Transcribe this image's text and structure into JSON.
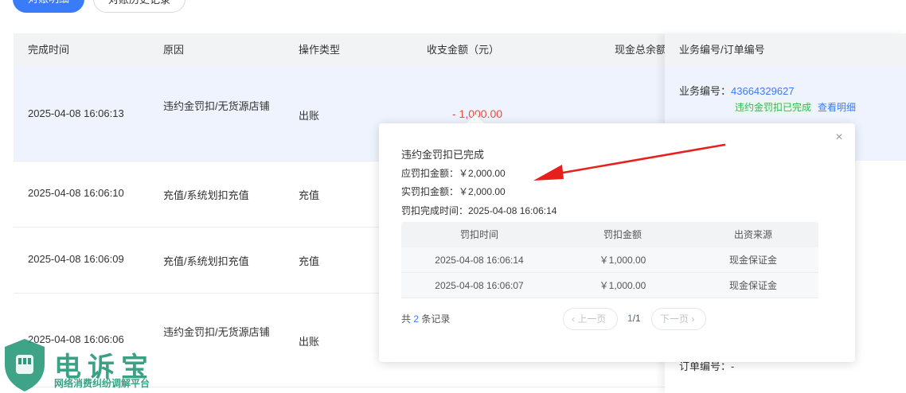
{
  "tabs": [
    {
      "label": "对账明细"
    },
    {
      "label": "对账历史记录"
    }
  ],
  "table": {
    "columns": [
      "完成时间",
      "原因",
      "操作类型",
      "收支金额（元）",
      "现金总余额",
      "业务编号/订单编号"
    ],
    "rows": [
      {
        "time": "2025-04-08 16:06:13",
        "reason": "违约金罚扣/无货源店铺",
        "op": "出账",
        "amount": "- 1,000.00"
      },
      {
        "time": "2025-04-08 16:06:10",
        "reason": "充值/系统划扣充值",
        "op": "充值"
      },
      {
        "time": "2025-04-08 16:06:09",
        "reason": "充值/系统划扣充值",
        "op": "充值"
      },
      {
        "time": "2025-04-08 16:06:06",
        "reason": "违约金罚扣/无货源店铺",
        "op": "出账"
      }
    ]
  },
  "right_column": {
    "biz_label": "业务编号：",
    "biz_number": "43664329627",
    "status_tag": "违约金罚扣已完成",
    "detail_link": "查看明细",
    "order_label": "订单编号：-"
  },
  "popover": {
    "title": "违约金罚扣已完成",
    "due_label": "应罚扣金额：￥2,000.00",
    "actual_label": "实罚扣金额：￥2,000.00",
    "finish_label": "罚扣完成时间：2025-04-08 16:06:14",
    "table_headers": [
      "罚扣时间",
      "罚扣金额",
      "出资来源"
    ],
    "table_rows": [
      [
        "2025-04-08 16:06:14",
        "￥1,000.00",
        "现金保证金"
      ],
      [
        "2025-04-08 16:06:07",
        "￥1,000.00",
        "现金保证金"
      ]
    ],
    "total_prefix": "共",
    "total_count": "2",
    "total_suffix": "条记录",
    "prev_label": "‹ 上一页",
    "next_label": "下一页 ›",
    "page_current": "1",
    "page_total": "/1",
    "close_icon": "×"
  },
  "watermark": {
    "title": "电诉宝",
    "subtitle": "网络消费纠纷调解平台"
  },
  "colors": {
    "primary": "#3a7bfa",
    "negative": "#f04a3f",
    "success": "#2dbb55",
    "annotation": "#e8201c",
    "watermark": "#2a9a7a"
  }
}
